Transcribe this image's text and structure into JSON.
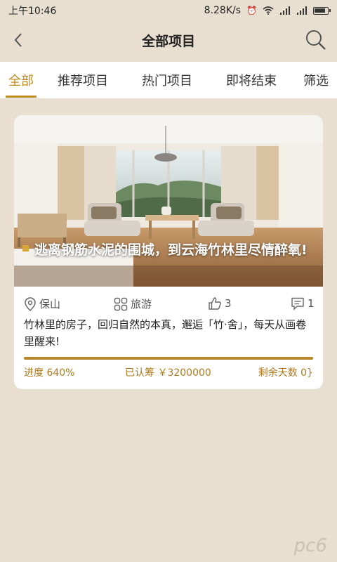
{
  "status": {
    "time": "上午10:46",
    "speed": "8.28K/s"
  },
  "header": {
    "title": "全部项目"
  },
  "tabs": [
    {
      "label": "全部"
    },
    {
      "label": "推荐项目"
    },
    {
      "label": "热门项目"
    },
    {
      "label": "即将结束"
    },
    {
      "label": "筛选"
    }
  ],
  "card": {
    "title": "逃离钢筋水泥的围城，到云海竹林里尽情醉氧!",
    "location": "保山",
    "category": "旅游",
    "likes": "3",
    "comments": "1",
    "description": "竹林里的房子，回归自然的本真，邂逅「竹·舍」，每天从画卷里醒来!",
    "progress_label": "进度 640%",
    "progress_fraction": 1.0,
    "raised": "已认筹 ￥3200000",
    "days_left": "剩余天数 0}"
  },
  "watermark": "pc6",
  "colors": {
    "accent": "#c08a1e",
    "background": "#e8dfd1",
    "progress": "#b7862a"
  }
}
